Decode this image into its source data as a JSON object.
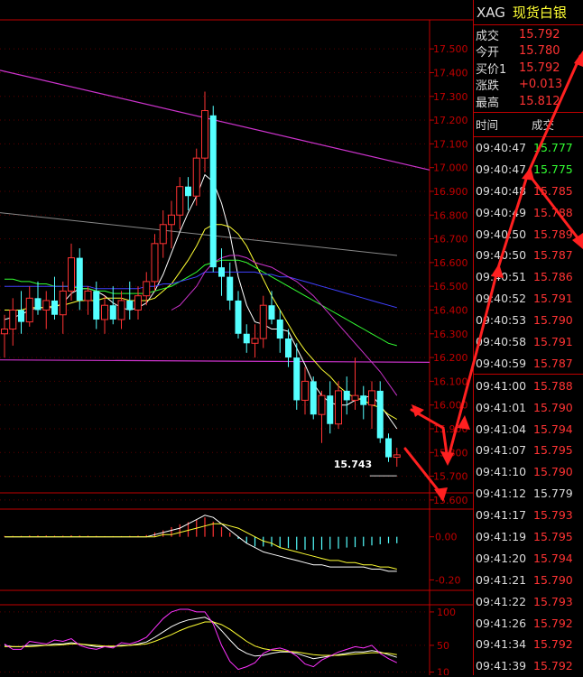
{
  "header": {
    "symbol": "XAG",
    "name": "现货白银"
  },
  "quote": [
    {
      "label": "成交",
      "value": "15.792"
    },
    {
      "label": "今开",
      "value": "15.780"
    },
    {
      "label": "买价1",
      "value": "15.792"
    },
    {
      "label": "涨跌",
      "value": "+0.013"
    },
    {
      "label": "最高",
      "value": "15.812"
    }
  ],
  "ticks_header": {
    "time": "时间",
    "price": "成交"
  },
  "ticks": [
    {
      "time": "09:40:47",
      "price": "15.777",
      "color": "#33ff33"
    },
    {
      "time": "09:40:47",
      "price": "15.775",
      "color": "#33ff33"
    },
    {
      "time": "09:40:48",
      "price": "15.785",
      "color": "#ff3333"
    },
    {
      "time": "09:40:49",
      "price": "15.788",
      "color": "#ff3333"
    },
    {
      "time": "09:40:50",
      "price": "15.789",
      "color": "#ff3333"
    },
    {
      "time": "09:40:50",
      "price": "15.787",
      "color": "#ff3333"
    },
    {
      "time": "09:40:51",
      "price": "15.786",
      "color": "#ff3333"
    },
    {
      "time": "09:40:52",
      "price": "15.791",
      "color": "#ff3333"
    },
    {
      "time": "09:40:53",
      "price": "15.790",
      "color": "#ff3333"
    },
    {
      "time": "09:40:58",
      "price": "15.791",
      "color": "#ff3333"
    },
    {
      "time": "09:40:59",
      "price": "15.787",
      "color": "#ff3333"
    },
    {
      "time": "09:41:00",
      "price": "15.788",
      "color": "#ff3333"
    },
    {
      "time": "09:41:01",
      "price": "15.790",
      "color": "#ff3333"
    },
    {
      "time": "09:41:04",
      "price": "15.794",
      "color": "#ff3333"
    },
    {
      "time": "09:41:07",
      "price": "15.795",
      "color": "#ff3333"
    },
    {
      "time": "09:41:10",
      "price": "15.790",
      "color": "#ff3333"
    },
    {
      "time": "09:41:12",
      "price": "15.779",
      "color": "#dcdcdc"
    },
    {
      "time": "09:41:17",
      "price": "15.793",
      "color": "#ff3333"
    },
    {
      "time": "09:41:19",
      "price": "15.795",
      "color": "#ff3333"
    },
    {
      "time": "09:41:20",
      "price": "15.794",
      "color": "#ff3333"
    },
    {
      "time": "09:41:21",
      "price": "15.790",
      "color": "#ff3333"
    },
    {
      "time": "09:41:22",
      "price": "15.793",
      "color": "#ff3333"
    },
    {
      "time": "09:41:26",
      "price": "15.792",
      "color": "#ff3333"
    },
    {
      "time": "09:41:34",
      "price": "15.792",
      "color": "#ff3333"
    },
    {
      "time": "09:41:39",
      "price": "15.792",
      "color": "#ff3333"
    }
  ],
  "chart_data": [
    {
      "type": "candlestick",
      "panel": "price",
      "ylim": [
        15.63,
        17.55
      ],
      "y_ticks": [
        "17.500",
        "17.400",
        "17.300",
        "17.200",
        "17.100",
        "17.000",
        "16.900",
        "16.800",
        "16.700",
        "16.600",
        "16.500",
        "16.400",
        "16.300",
        "16.200",
        "16.100",
        "16.000",
        "15.900",
        "15.800",
        "15.700",
        "15.600"
      ],
      "last_price_label": "15.743",
      "up_color": "#ff3333",
      "down_color": "#54ffff",
      "candles": [
        [
          16.3,
          16.38,
          16.2,
          16.32
        ],
        [
          16.32,
          16.45,
          16.25,
          16.4
        ],
        [
          16.4,
          16.48,
          16.3,
          16.35
        ],
        [
          16.35,
          16.5,
          16.33,
          16.45
        ],
        [
          16.45,
          16.52,
          16.38,
          16.4
        ],
        [
          16.4,
          16.48,
          16.32,
          16.44
        ],
        [
          16.44,
          16.54,
          16.36,
          16.38
        ],
        [
          16.38,
          16.52,
          16.3,
          16.48
        ],
        [
          16.48,
          16.68,
          16.44,
          16.62
        ],
        [
          16.62,
          16.66,
          16.4,
          16.44
        ],
        [
          16.44,
          16.5,
          16.38,
          16.48
        ],
        [
          16.48,
          16.52,
          16.32,
          16.36
        ],
        [
          16.36,
          16.46,
          16.3,
          16.42
        ],
        [
          16.42,
          16.5,
          16.34,
          16.36
        ],
        [
          16.36,
          16.48,
          16.32,
          16.44
        ],
        [
          16.44,
          16.52,
          16.36,
          16.4
        ],
        [
          16.4,
          16.5,
          16.36,
          16.46
        ],
        [
          16.46,
          16.56,
          16.42,
          16.52
        ],
        [
          16.52,
          16.72,
          16.48,
          16.68
        ],
        [
          16.68,
          16.82,
          16.62,
          16.76
        ],
        [
          16.76,
          16.86,
          16.66,
          16.8
        ],
        [
          16.8,
          16.96,
          16.74,
          16.92
        ],
        [
          16.92,
          16.96,
          16.82,
          16.88
        ],
        [
          16.88,
          17.08,
          16.84,
          17.04
        ],
        [
          17.04,
          17.32,
          16.98,
          17.24
        ],
        [
          17.22,
          17.26,
          16.56,
          16.58
        ],
        [
          16.58,
          16.66,
          16.46,
          16.54
        ],
        [
          16.54,
          16.6,
          16.4,
          16.44
        ],
        [
          16.44,
          16.48,
          16.28,
          16.3
        ],
        [
          16.3,
          16.34,
          16.22,
          16.26
        ],
        [
          16.26,
          16.34,
          16.2,
          16.28
        ],
        [
          16.28,
          16.46,
          16.24,
          16.42
        ],
        [
          16.42,
          16.48,
          16.34,
          16.36
        ],
        [
          16.36,
          16.4,
          16.22,
          16.28
        ],
        [
          16.28,
          16.32,
          16.16,
          16.2
        ],
        [
          16.2,
          16.26,
          15.98,
          16.02
        ],
        [
          16.02,
          16.16,
          15.96,
          16.1
        ],
        [
          16.1,
          16.12,
          15.94,
          15.96
        ],
        [
          15.96,
          16.06,
          15.84,
          16.04
        ],
        [
          16.04,
          16.1,
          15.88,
          15.92
        ],
        [
          15.92,
          16.1,
          15.9,
          16.06
        ],
        [
          16.06,
          16.12,
          15.96,
          16.02
        ],
        [
          16.02,
          16.2,
          15.98,
          16.04
        ],
        [
          16.04,
          16.08,
          15.94,
          16.0
        ],
        [
          16.0,
          16.1,
          15.9,
          16.06
        ],
        [
          16.06,
          16.1,
          15.84,
          15.86
        ],
        [
          15.86,
          15.88,
          15.76,
          15.78
        ],
        [
          15.78,
          15.82,
          15.74,
          15.79
        ]
      ],
      "ma": [
        {
          "color": "#ffffff",
          "values": [
            16.36,
            16.37,
            16.38,
            16.4,
            16.41,
            16.41,
            16.41,
            16.43,
            16.47,
            16.49,
            16.49,
            16.48,
            16.46,
            16.43,
            16.41,
            16.4,
            16.41,
            16.43,
            16.48,
            16.55,
            16.64,
            16.73,
            16.81,
            16.88,
            16.97,
            16.94,
            16.85,
            16.72,
            16.54,
            16.42,
            16.35,
            16.34,
            16.32,
            16.32,
            16.31,
            16.24,
            16.17,
            16.09,
            16.04,
            16.01,
            16.0,
            16.0,
            16.02,
            16.03,
            16.04,
            16.0,
            15.95,
            15.9
          ]
        },
        {
          "color": "#ffff33",
          "values": [
            16.4,
            16.4,
            16.4,
            16.41,
            16.41,
            16.41,
            16.42,
            16.42,
            16.43,
            16.44,
            16.44,
            16.44,
            16.45,
            16.45,
            16.45,
            16.44,
            16.44,
            16.44,
            16.45,
            16.48,
            16.51,
            16.56,
            16.61,
            16.67,
            16.74,
            16.76,
            16.76,
            16.75,
            16.72,
            16.67,
            16.6,
            16.53,
            16.46,
            16.4,
            16.34,
            16.28,
            16.23,
            16.19,
            16.15,
            16.12,
            16.08,
            16.05,
            16.03,
            16.02,
            16.0,
            15.99,
            15.96,
            15.94
          ]
        },
        {
          "color": "#33ff33",
          "values": [
            16.53,
            16.53,
            16.52,
            16.52,
            16.51,
            16.51,
            16.5,
            16.5,
            16.5,
            16.49,
            16.49,
            16.48,
            16.48,
            16.47,
            16.47,
            16.47,
            16.47,
            16.47,
            16.48,
            16.49,
            16.5,
            16.52,
            16.54,
            16.56,
            16.59,
            16.6,
            16.61,
            16.61,
            16.61,
            16.6,
            16.58,
            16.56,
            16.54,
            16.52,
            16.5,
            16.48,
            16.46,
            16.44,
            16.42,
            16.4,
            16.38,
            16.36,
            16.34,
            16.32,
            16.3,
            16.28,
            16.26,
            16.25
          ]
        },
        {
          "color": "#4040ff",
          "values": [
            16.5,
            16.5,
            16.5,
            16.5,
            16.5,
            16.5,
            16.5,
            16.5,
            16.5,
            16.5,
            16.5,
            16.49,
            16.49,
            16.49,
            16.49,
            16.49,
            16.49,
            16.5,
            16.5,
            16.51,
            16.51,
            16.52,
            16.53,
            16.54,
            16.56,
            16.56,
            16.56,
            16.56,
            16.56,
            16.56,
            16.56,
            16.55,
            16.55,
            16.54,
            16.54,
            16.53,
            16.52,
            16.51,
            16.5,
            16.49,
            16.48,
            16.47,
            16.46,
            16.45,
            16.44,
            16.43,
            16.42,
            16.41
          ]
        },
        {
          "color": "#cc33cc",
          "values": [
            null,
            null,
            null,
            null,
            null,
            null,
            null,
            null,
            null,
            null,
            null,
            null,
            null,
            null,
            null,
            null,
            null,
            null,
            null,
            null,
            16.4,
            16.42,
            16.46,
            16.5,
            16.56,
            16.6,
            16.62,
            16.63,
            16.63,
            16.62,
            16.6,
            16.59,
            16.58,
            16.56,
            16.54,
            16.52,
            16.49,
            16.46,
            16.42,
            16.38,
            16.34,
            16.3,
            16.26,
            16.22,
            16.18,
            16.14,
            16.09,
            16.04
          ]
        }
      ]
    },
    {
      "type": "bar",
      "panel": "macd",
      "ylim": [
        -0.24,
        0.12
      ],
      "y_ticks": [
        "0.00",
        "-0.20"
      ],
      "histogram": [
        0.004,
        0.004,
        0.004,
        0.006,
        0.006,
        0.006,
        0.005,
        0.005,
        0.007,
        0.006,
        0.005,
        0.004,
        0.003,
        0.003,
        0.003,
        0.004,
        0.005,
        0.008,
        0.02,
        0.03,
        0.045,
        0.058,
        0.068,
        0.078,
        0.09,
        0.07,
        0.045,
        0.02,
        -0.01,
        -0.03,
        -0.045,
        -0.045,
        -0.045,
        -0.048,
        -0.052,
        -0.06,
        -0.06,
        -0.062,
        -0.06,
        -0.058,
        -0.055,
        -0.05,
        -0.048,
        -0.044,
        -0.04,
        -0.035,
        -0.03,
        -0.03
      ],
      "dif": [
        0.0,
        0.0,
        0.0,
        0.0,
        0.0,
        0.0,
        0.0,
        0.0,
        0.0,
        0.0,
        0.0,
        0.0,
        0.0,
        0.0,
        0.0,
        0.0,
        0.0,
        0.0,
        0.01,
        0.02,
        0.03,
        0.04,
        0.06,
        0.08,
        0.1,
        0.09,
        0.06,
        0.03,
        0.0,
        -0.03,
        -0.05,
        -0.07,
        -0.08,
        -0.09,
        -0.1,
        -0.11,
        -0.12,
        -0.13,
        -0.13,
        -0.14,
        -0.14,
        -0.14,
        -0.14,
        -0.14,
        -0.15,
        -0.15,
        -0.16,
        -0.16
      ],
      "dea": [
        0.0,
        0.0,
        0.0,
        0.0,
        0.0,
        0.0,
        0.0,
        0.0,
        0.0,
        0.0,
        0.0,
        0.0,
        0.0,
        0.0,
        0.0,
        0.0,
        0.0,
        0.0,
        0.0,
        0.01,
        0.01,
        0.02,
        0.03,
        0.04,
        0.05,
        0.06,
        0.06,
        0.05,
        0.04,
        0.02,
        0.0,
        -0.02,
        -0.03,
        -0.05,
        -0.06,
        -0.07,
        -0.08,
        -0.09,
        -0.1,
        -0.11,
        -0.11,
        -0.12,
        -0.12,
        -0.13,
        -0.13,
        -0.14,
        -0.14,
        -0.15
      ]
    },
    {
      "type": "line",
      "panel": "kdj",
      "ylim": [
        8,
        108
      ],
      "y_ticks": [
        "100",
        "50",
        "10"
      ],
      "series": [
        {
          "color": "#ffffff",
          "values": [
            50,
            48,
            48,
            50,
            50,
            50,
            52,
            52,
            54,
            52,
            50,
            48,
            48,
            48,
            50,
            50,
            52,
            55,
            62,
            70,
            78,
            84,
            88,
            90,
            92,
            85,
            72,
            58,
            45,
            38,
            34,
            35,
            38,
            40,
            40,
            38,
            34,
            30,
            32,
            34,
            36,
            38,
            40,
            40,
            42,
            40,
            36,
            32
          ]
        },
        {
          "color": "#ffff33",
          "values": [
            48,
            48,
            48,
            48,
            49,
            50,
            50,
            51,
            52,
            52,
            51,
            50,
            49,
            49,
            49,
            50,
            51,
            52,
            56,
            61,
            66,
            72,
            77,
            81,
            85,
            85,
            81,
            74,
            65,
            56,
            49,
            45,
            43,
            42,
            41,
            40,
            38,
            36,
            35,
            35,
            35,
            36,
            37,
            38,
            39,
            39,
            38,
            36
          ]
        },
        {
          "color": "#ff33ff",
          "values": [
            52,
            44,
            44,
            56,
            54,
            52,
            58,
            56,
            60,
            50,
            46,
            44,
            48,
            46,
            54,
            52,
            56,
            62,
            76,
            90,
            100,
            104,
            104,
            100,
            100,
            82,
            50,
            26,
            14,
            18,
            24,
            38,
            44,
            46,
            42,
            34,
            22,
            18,
            28,
            34,
            40,
            44,
            48,
            46,
            50,
            38,
            30,
            24
          ]
        }
      ]
    }
  ]
}
